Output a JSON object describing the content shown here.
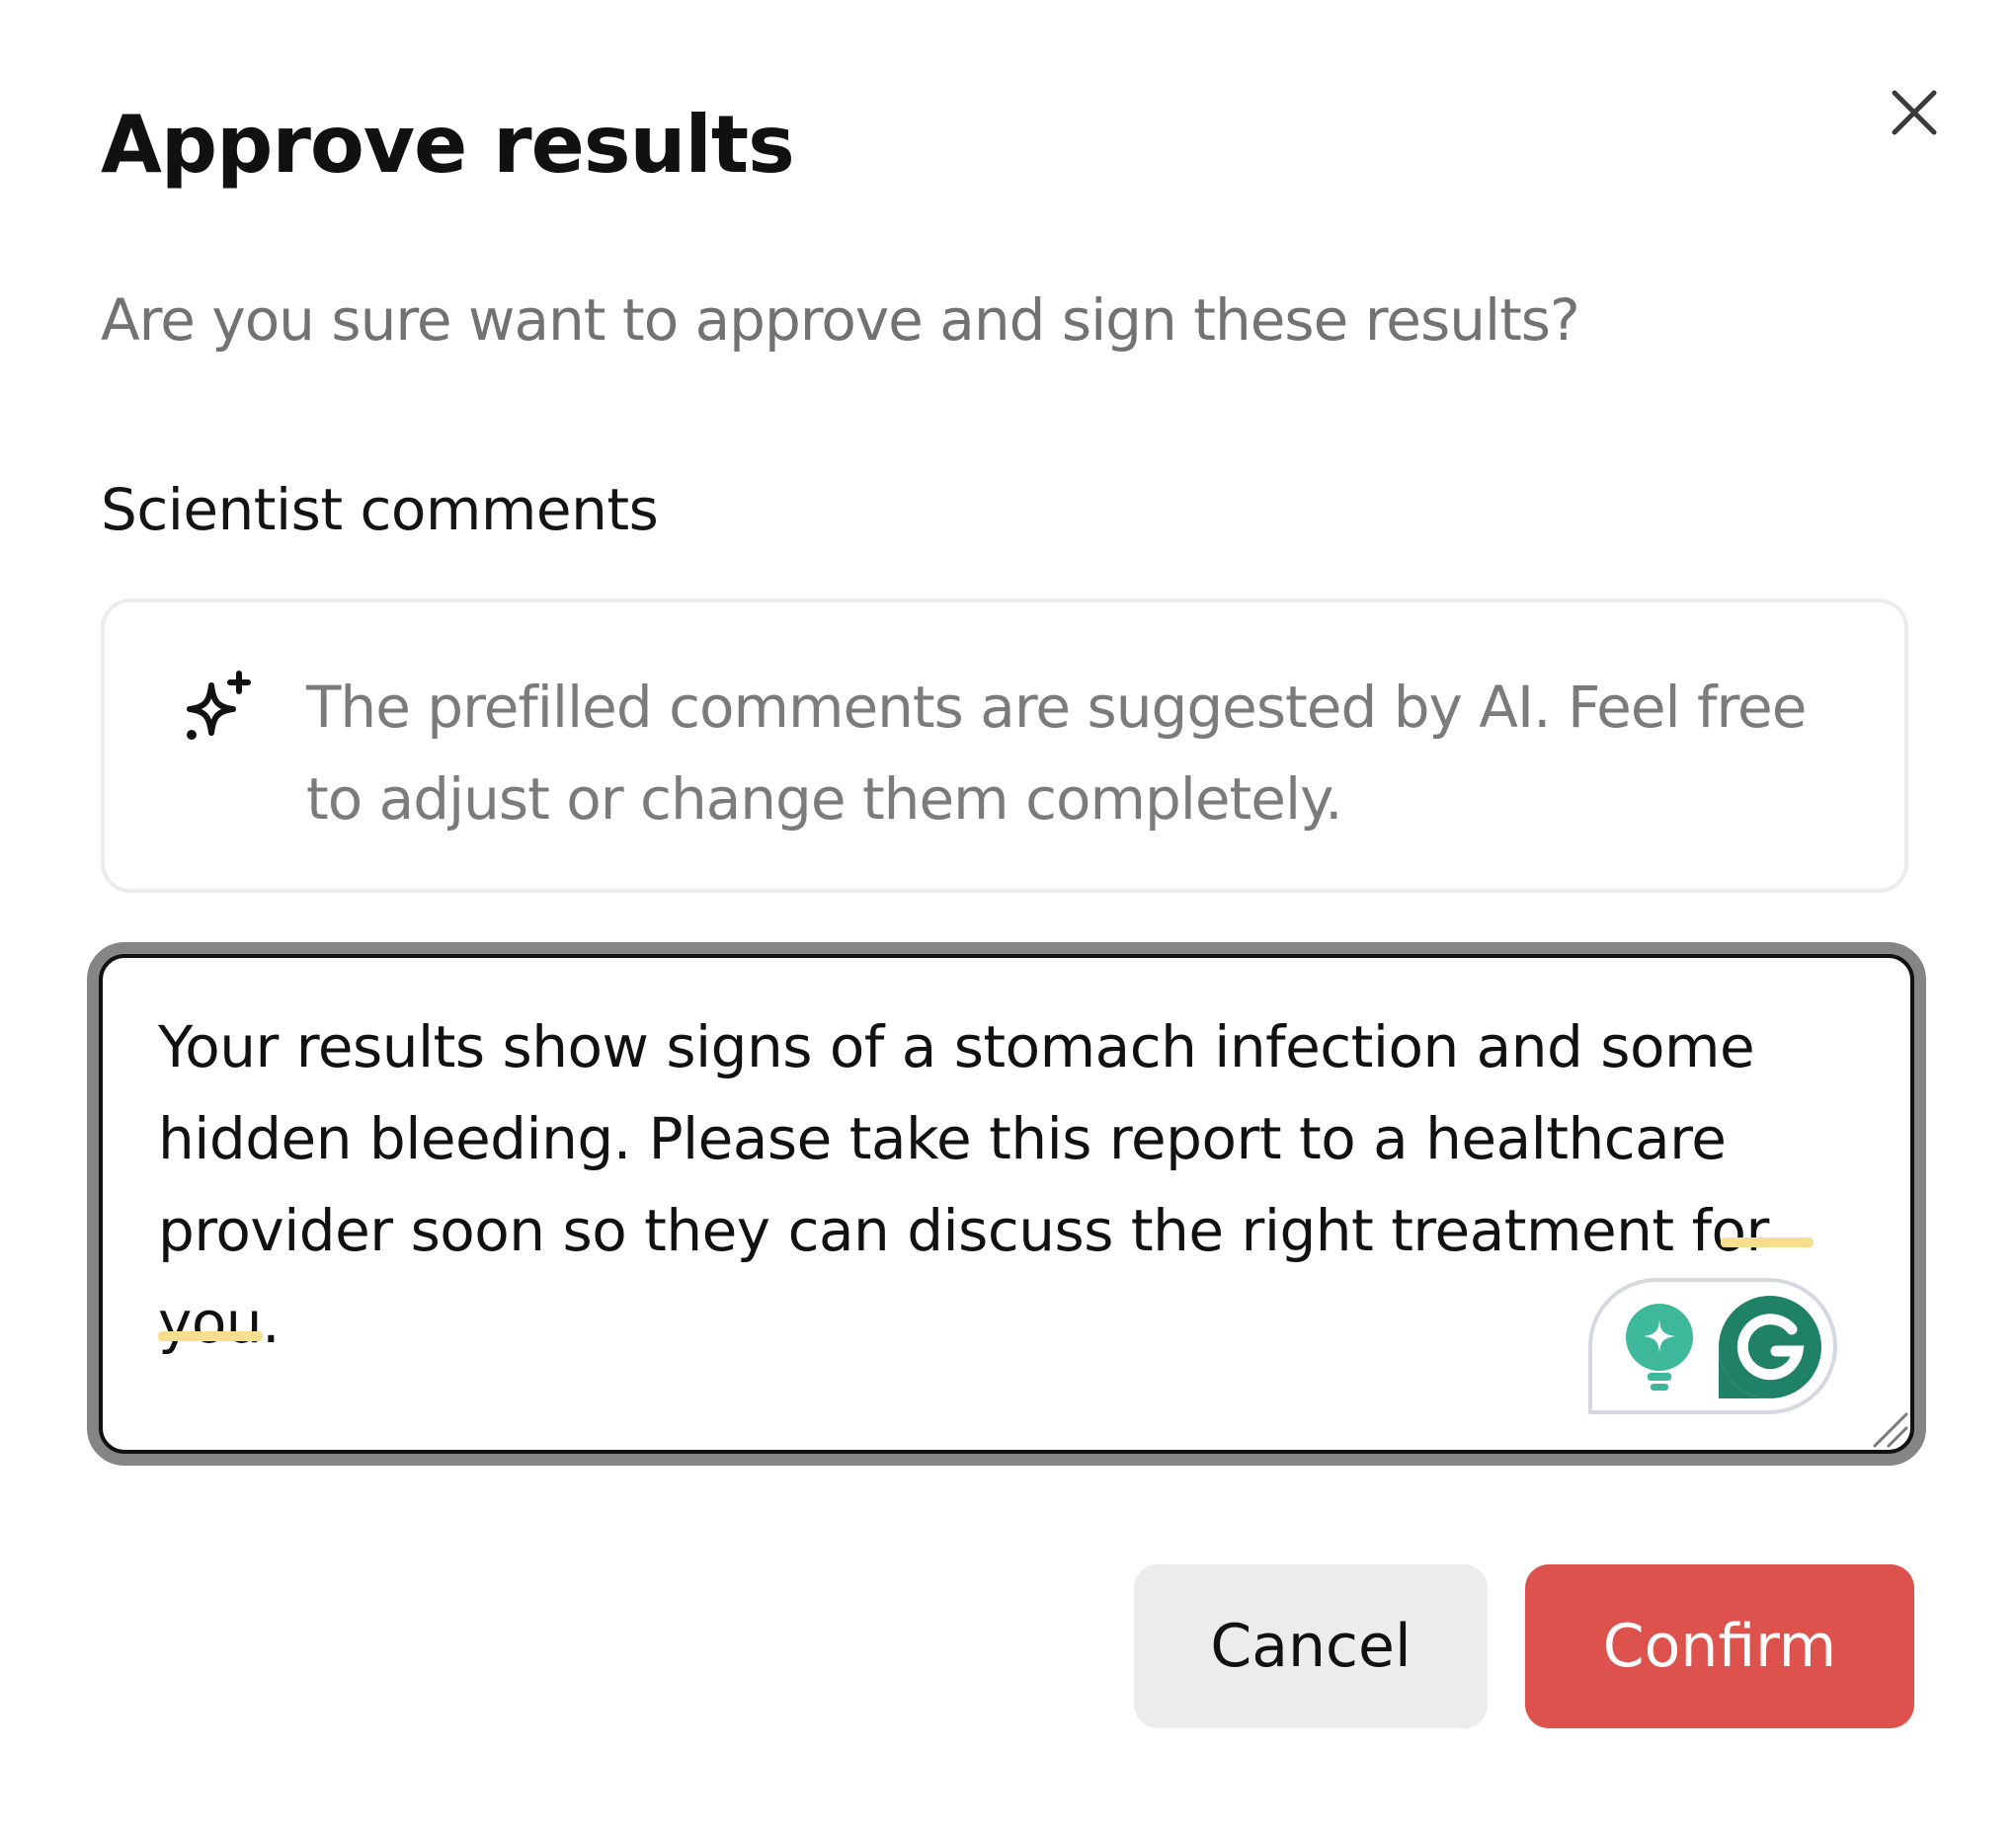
{
  "dialog": {
    "title": "Approve results",
    "subtitle": "Are you sure want to approve and sign these results?",
    "close_icon": "close-icon"
  },
  "comments": {
    "section_label": "Scientist comments",
    "ai_note": {
      "icon": "sparkle-icon",
      "text": "The prefilled comments are suggested by AI. Feel free to adjust or change them completely."
    },
    "text_value": "Your results show signs of a stomach infection and some hidden bleeding. Please take this report to a healthcare provider soon so they can discuss the right treatment for you.",
    "grammarly": {
      "suggestion_icon": "lightbulb-icon",
      "logo_icon": "grammarly-g-icon",
      "colors": {
        "teal": "#3db89a",
        "dark_green": "#1f8165"
      }
    },
    "flag_color": "#f7df8f"
  },
  "actions": {
    "cancel_label": "Cancel",
    "confirm_label": "Confirm",
    "confirm_color": "#dd524d",
    "cancel_color": "#ececec"
  }
}
